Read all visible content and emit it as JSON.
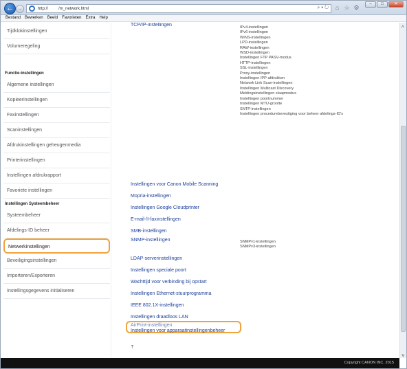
{
  "window": {
    "url": "http://         /m_network.html",
    "address_tools": "⌕ ▾ ↻",
    "close_glyph": "✕",
    "maximize_glyph": "□",
    "minimize_glyph": "–"
  },
  "menu": [
    "Bestand",
    "Bewerken",
    "Beeld",
    "Favorieten",
    "Extra",
    "Help"
  ],
  "sidebar": {
    "items_top": [
      "Tijdklokinstellingen",
      "Volumeregeling"
    ],
    "head_functions": "Functie-instellingen",
    "items_functions": [
      "Algemene instellingen",
      "Kopieerinstellingen",
      "Faxinstellingen",
      "Scaninstellingen",
      "Afdrukinstellingen geheugenmedia",
      "Printerinstellingen",
      "Instellingen afdrukrapport",
      "Favoriete instellingen"
    ],
    "head_system": "Instellingen Systeembeheer",
    "items_system": [
      "Systeembeheer",
      "Afdelings-ID beheer",
      "Netwerkinstellingen",
      "Beveiligingsinstellingen",
      "Importeren/Exporteren",
      "Instellingsgegevens initialiseren"
    ]
  },
  "main": {
    "tcpip": "TCP/IP-instellingen",
    "tcpip_sub": [
      "IPv4-instellingen",
      "IPv6-instellingen",
      "WINS-instellingen",
      "LPD-instellingen",
      "RAW-instellingen",
      "WSD-instellingen",
      "Instellingen FTP PASV-modus",
      "HTTP-instellingen",
      "SSL-instellingen",
      "Proxy-instellingen",
      "Instellingen IPP-afdrukken",
      "Network Link Scan-instellingen",
      "Instellingen Multicast Discovery",
      "Meldingsinstellingen slaapmodus",
      "Instellingen poortnummer",
      "Instellingen MTU-grootte",
      "SNTP-instellingen",
      "Instellingen procedurebevestiging voor beheer afdelings-ID's"
    ],
    "links": [
      "Instellingen voor Canon Mobile Scanning",
      "Mopria-instellingen",
      "Instellingen Google Cloudprinter",
      "E-mail-/I-faxinstellingen",
      "SMB-instellingen",
      "SNMP-instellingen"
    ],
    "snmp_sub": [
      "SNMPv1-instellingen",
      "SNMPv3-instellingen"
    ],
    "links2": [
      "LDAP-serverinstellingen",
      "Instellingen speciale poort",
      "Wachttijd voor verbinding bij opstart",
      "Instellingen Ethernet-stuurprogramma",
      "IEEE 802.1X-instellingen",
      "Instellingen draadloos LAN",
      "AirPrint-instellingen",
      "Instellingen voor apparaatinstellingenbeheer"
    ],
    "top_anchor": "⤒"
  },
  "footer": "Copyright CANON INC. 2015",
  "colors": {
    "highlight": "#f0a23b",
    "link": "#1c3f9a",
    "footer_bg": "#111111"
  }
}
